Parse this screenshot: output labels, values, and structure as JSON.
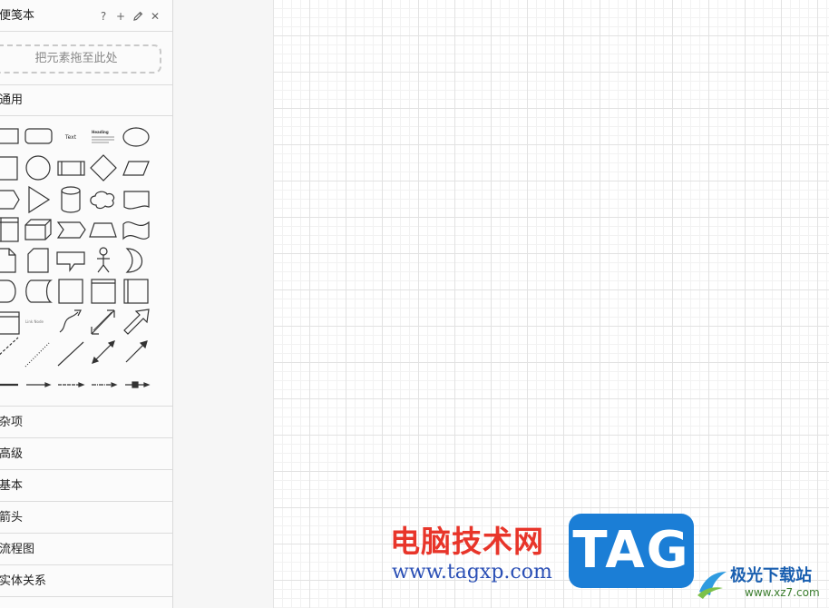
{
  "scratchpad": {
    "title": "便笺本",
    "drop_hint": "把元素拖至此处",
    "tools": {
      "help": "?",
      "add": "+",
      "close": "✕"
    }
  },
  "general": {
    "title": "通用",
    "shape_text_label": "Text",
    "shape_heading_label": "Heading",
    "shape_link_label": "Link Node"
  },
  "categories": [
    "杂项",
    "高级",
    "基本",
    "箭头",
    "流程图",
    "实体关系"
  ],
  "watermark": {
    "title": "电脑技术网",
    "url": "www.tagxp.com",
    "tag": "TAG",
    "site_name": "极光下载站",
    "site_url": "www.xz7.com"
  }
}
